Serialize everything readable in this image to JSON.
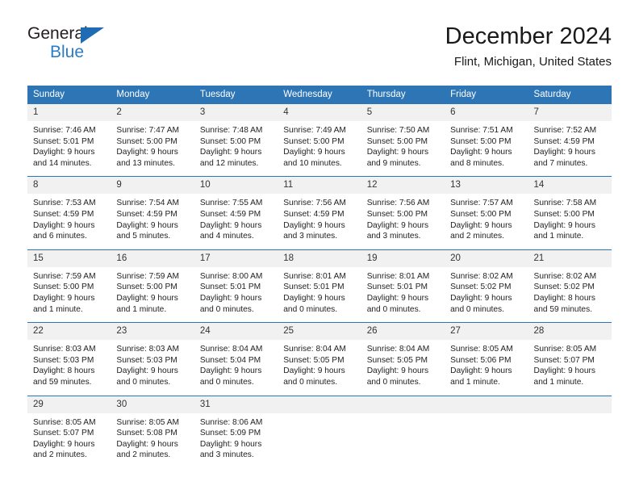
{
  "brand": {
    "name_top": "General",
    "name_bottom": "Blue"
  },
  "header": {
    "title": "December 2024",
    "location": "Flint, Michigan, United States"
  },
  "colors": {
    "header_blue": "#2e75b6",
    "brand_blue": "#2b7cc4",
    "daynum_band": "#f1f1f1",
    "row_rule": "#2e75b6"
  },
  "weekdays": [
    "Sunday",
    "Monday",
    "Tuesday",
    "Wednesday",
    "Thursday",
    "Friday",
    "Saturday"
  ],
  "weeks": [
    [
      {
        "day": "1",
        "sunrise": "Sunrise: 7:46 AM",
        "sunset": "Sunset: 5:01 PM",
        "daylight_1": "Daylight: 9 hours",
        "daylight_2": "and 14 minutes."
      },
      {
        "day": "2",
        "sunrise": "Sunrise: 7:47 AM",
        "sunset": "Sunset: 5:00 PM",
        "daylight_1": "Daylight: 9 hours",
        "daylight_2": "and 13 minutes."
      },
      {
        "day": "3",
        "sunrise": "Sunrise: 7:48 AM",
        "sunset": "Sunset: 5:00 PM",
        "daylight_1": "Daylight: 9 hours",
        "daylight_2": "and 12 minutes."
      },
      {
        "day": "4",
        "sunrise": "Sunrise: 7:49 AM",
        "sunset": "Sunset: 5:00 PM",
        "daylight_1": "Daylight: 9 hours",
        "daylight_2": "and 10 minutes."
      },
      {
        "day": "5",
        "sunrise": "Sunrise: 7:50 AM",
        "sunset": "Sunset: 5:00 PM",
        "daylight_1": "Daylight: 9 hours",
        "daylight_2": "and 9 minutes."
      },
      {
        "day": "6",
        "sunrise": "Sunrise: 7:51 AM",
        "sunset": "Sunset: 5:00 PM",
        "daylight_1": "Daylight: 9 hours",
        "daylight_2": "and 8 minutes."
      },
      {
        "day": "7",
        "sunrise": "Sunrise: 7:52 AM",
        "sunset": "Sunset: 4:59 PM",
        "daylight_1": "Daylight: 9 hours",
        "daylight_2": "and 7 minutes."
      }
    ],
    [
      {
        "day": "8",
        "sunrise": "Sunrise: 7:53 AM",
        "sunset": "Sunset: 4:59 PM",
        "daylight_1": "Daylight: 9 hours",
        "daylight_2": "and 6 minutes."
      },
      {
        "day": "9",
        "sunrise": "Sunrise: 7:54 AM",
        "sunset": "Sunset: 4:59 PM",
        "daylight_1": "Daylight: 9 hours",
        "daylight_2": "and 5 minutes."
      },
      {
        "day": "10",
        "sunrise": "Sunrise: 7:55 AM",
        "sunset": "Sunset: 4:59 PM",
        "daylight_1": "Daylight: 9 hours",
        "daylight_2": "and 4 minutes."
      },
      {
        "day": "11",
        "sunrise": "Sunrise: 7:56 AM",
        "sunset": "Sunset: 4:59 PM",
        "daylight_1": "Daylight: 9 hours",
        "daylight_2": "and 3 minutes."
      },
      {
        "day": "12",
        "sunrise": "Sunrise: 7:56 AM",
        "sunset": "Sunset: 5:00 PM",
        "daylight_1": "Daylight: 9 hours",
        "daylight_2": "and 3 minutes."
      },
      {
        "day": "13",
        "sunrise": "Sunrise: 7:57 AM",
        "sunset": "Sunset: 5:00 PM",
        "daylight_1": "Daylight: 9 hours",
        "daylight_2": "and 2 minutes."
      },
      {
        "day": "14",
        "sunrise": "Sunrise: 7:58 AM",
        "sunset": "Sunset: 5:00 PM",
        "daylight_1": "Daylight: 9 hours",
        "daylight_2": "and 1 minute."
      }
    ],
    [
      {
        "day": "15",
        "sunrise": "Sunrise: 7:59 AM",
        "sunset": "Sunset: 5:00 PM",
        "daylight_1": "Daylight: 9 hours",
        "daylight_2": "and 1 minute."
      },
      {
        "day": "16",
        "sunrise": "Sunrise: 7:59 AM",
        "sunset": "Sunset: 5:00 PM",
        "daylight_1": "Daylight: 9 hours",
        "daylight_2": "and 1 minute."
      },
      {
        "day": "17",
        "sunrise": "Sunrise: 8:00 AM",
        "sunset": "Sunset: 5:01 PM",
        "daylight_1": "Daylight: 9 hours",
        "daylight_2": "and 0 minutes."
      },
      {
        "day": "18",
        "sunrise": "Sunrise: 8:01 AM",
        "sunset": "Sunset: 5:01 PM",
        "daylight_1": "Daylight: 9 hours",
        "daylight_2": "and 0 minutes."
      },
      {
        "day": "19",
        "sunrise": "Sunrise: 8:01 AM",
        "sunset": "Sunset: 5:01 PM",
        "daylight_1": "Daylight: 9 hours",
        "daylight_2": "and 0 minutes."
      },
      {
        "day": "20",
        "sunrise": "Sunrise: 8:02 AM",
        "sunset": "Sunset: 5:02 PM",
        "daylight_1": "Daylight: 9 hours",
        "daylight_2": "and 0 minutes."
      },
      {
        "day": "21",
        "sunrise": "Sunrise: 8:02 AM",
        "sunset": "Sunset: 5:02 PM",
        "daylight_1": "Daylight: 8 hours",
        "daylight_2": "and 59 minutes."
      }
    ],
    [
      {
        "day": "22",
        "sunrise": "Sunrise: 8:03 AM",
        "sunset": "Sunset: 5:03 PM",
        "daylight_1": "Daylight: 8 hours",
        "daylight_2": "and 59 minutes."
      },
      {
        "day": "23",
        "sunrise": "Sunrise: 8:03 AM",
        "sunset": "Sunset: 5:03 PM",
        "daylight_1": "Daylight: 9 hours",
        "daylight_2": "and 0 minutes."
      },
      {
        "day": "24",
        "sunrise": "Sunrise: 8:04 AM",
        "sunset": "Sunset: 5:04 PM",
        "daylight_1": "Daylight: 9 hours",
        "daylight_2": "and 0 minutes."
      },
      {
        "day": "25",
        "sunrise": "Sunrise: 8:04 AM",
        "sunset": "Sunset: 5:05 PM",
        "daylight_1": "Daylight: 9 hours",
        "daylight_2": "and 0 minutes."
      },
      {
        "day": "26",
        "sunrise": "Sunrise: 8:04 AM",
        "sunset": "Sunset: 5:05 PM",
        "daylight_1": "Daylight: 9 hours",
        "daylight_2": "and 0 minutes."
      },
      {
        "day": "27",
        "sunrise": "Sunrise: 8:05 AM",
        "sunset": "Sunset: 5:06 PM",
        "daylight_1": "Daylight: 9 hours",
        "daylight_2": "and 1 minute."
      },
      {
        "day": "28",
        "sunrise": "Sunrise: 8:05 AM",
        "sunset": "Sunset: 5:07 PM",
        "daylight_1": "Daylight: 9 hours",
        "daylight_2": "and 1 minute."
      }
    ],
    [
      {
        "day": "29",
        "sunrise": "Sunrise: 8:05 AM",
        "sunset": "Sunset: 5:07 PM",
        "daylight_1": "Daylight: 9 hours",
        "daylight_2": "and 2 minutes."
      },
      {
        "day": "30",
        "sunrise": "Sunrise: 8:05 AM",
        "sunset": "Sunset: 5:08 PM",
        "daylight_1": "Daylight: 9 hours",
        "daylight_2": "and 2 minutes."
      },
      {
        "day": "31",
        "sunrise": "Sunrise: 8:06 AM",
        "sunset": "Sunset: 5:09 PM",
        "daylight_1": "Daylight: 9 hours",
        "daylight_2": "and 3 minutes."
      },
      {
        "day": "",
        "sunrise": "",
        "sunset": "",
        "daylight_1": "",
        "daylight_2": ""
      },
      {
        "day": "",
        "sunrise": "",
        "sunset": "",
        "daylight_1": "",
        "daylight_2": ""
      },
      {
        "day": "",
        "sunrise": "",
        "sunset": "",
        "daylight_1": "",
        "daylight_2": ""
      },
      {
        "day": "",
        "sunrise": "",
        "sunset": "",
        "daylight_1": "",
        "daylight_2": ""
      }
    ]
  ]
}
